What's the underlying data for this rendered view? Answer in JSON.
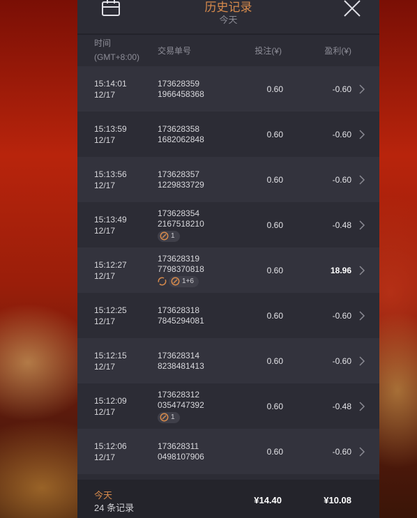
{
  "header": {
    "title": "历史记录",
    "subtitle": "今天"
  },
  "columns": {
    "time_line1": "时间",
    "time_line2": "(GMT+8:00)",
    "transaction": "交易单号",
    "bet": "投注(¥)",
    "profit": "盈利(¥)"
  },
  "rows": [
    {
      "time": "15:14:01",
      "date": "12/17",
      "tx1": "173628359",
      "tx2": "1966458368",
      "bet": "0.60",
      "profit": "-0.60"
    },
    {
      "time": "15:13:59",
      "date": "12/17",
      "tx1": "173628358",
      "tx2": "1682062848",
      "bet": "0.60",
      "profit": "-0.60"
    },
    {
      "time": "15:13:56",
      "date": "12/17",
      "tx1": "173628357",
      "tx2": "1229833729",
      "bet": "0.60",
      "profit": "-0.60"
    },
    {
      "time": "15:13:49",
      "date": "12/17",
      "tx1": "173628354",
      "tx2": "2167518210",
      "bet": "0.60",
      "profit": "-0.48",
      "badge": "1"
    },
    {
      "time": "15:12:27",
      "date": "12/17",
      "tx1": "173628319",
      "tx2": "7798370818",
      "bet": "0.60",
      "profit": "18.96",
      "badge": "1+6"
    },
    {
      "time": "15:12:25",
      "date": "12/17",
      "tx1": "173628318",
      "tx2": "7845294081",
      "bet": "0.60",
      "profit": "-0.60"
    },
    {
      "time": "15:12:15",
      "date": "12/17",
      "tx1": "173628314",
      "tx2": "8238481413",
      "bet": "0.60",
      "profit": "-0.60"
    },
    {
      "time": "15:12:09",
      "date": "12/17",
      "tx1": "173628312",
      "tx2": "0354747392",
      "bet": "0.60",
      "profit": "-0.48",
      "badge": "1"
    },
    {
      "time": "15:12:06",
      "date": "12/17",
      "tx1": "173628311",
      "tx2": "0498107906",
      "bet": "0.60",
      "profit": "-0.60"
    }
  ],
  "footer": {
    "period": "今天",
    "count": "24 条记录",
    "total_bet": "¥14.40",
    "total_profit": "¥10.08"
  },
  "colors": {
    "accent": "#d68a4c",
    "panel": "#2c2c35",
    "row_alt": "#33333d"
  }
}
